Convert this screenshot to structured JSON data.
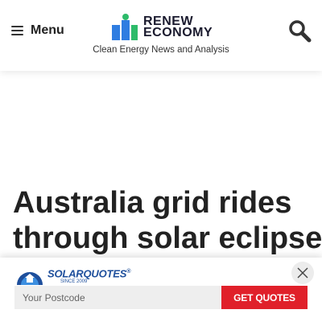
{
  "header": {
    "menu_label": "Menu",
    "logo": {
      "line1": "RENEW",
      "line2": "ECONOMY"
    },
    "tagline": "Clean Energy News and Analysis"
  },
  "article": {
    "headline_line1": "Australia grid rides",
    "headline_line2": "through solar eclipse,"
  },
  "sticky_ad": {
    "brand": "SOLARQUOTES",
    "brand_mark": "®",
    "since": "SINCE 2009",
    "postcode_placeholder": "Your Postcode",
    "button_label": "GET QUOTES"
  },
  "colors": {
    "logo_blue": "#2f7de1",
    "logo_green": "#2dbb6a",
    "cta_red": "#e0202a",
    "solarquotes_blue": "#1e4f9c"
  },
  "icons": [
    "menu-icon",
    "search-icon",
    "close-icon",
    "renew-economy-logo",
    "solarquotes-logo"
  ]
}
